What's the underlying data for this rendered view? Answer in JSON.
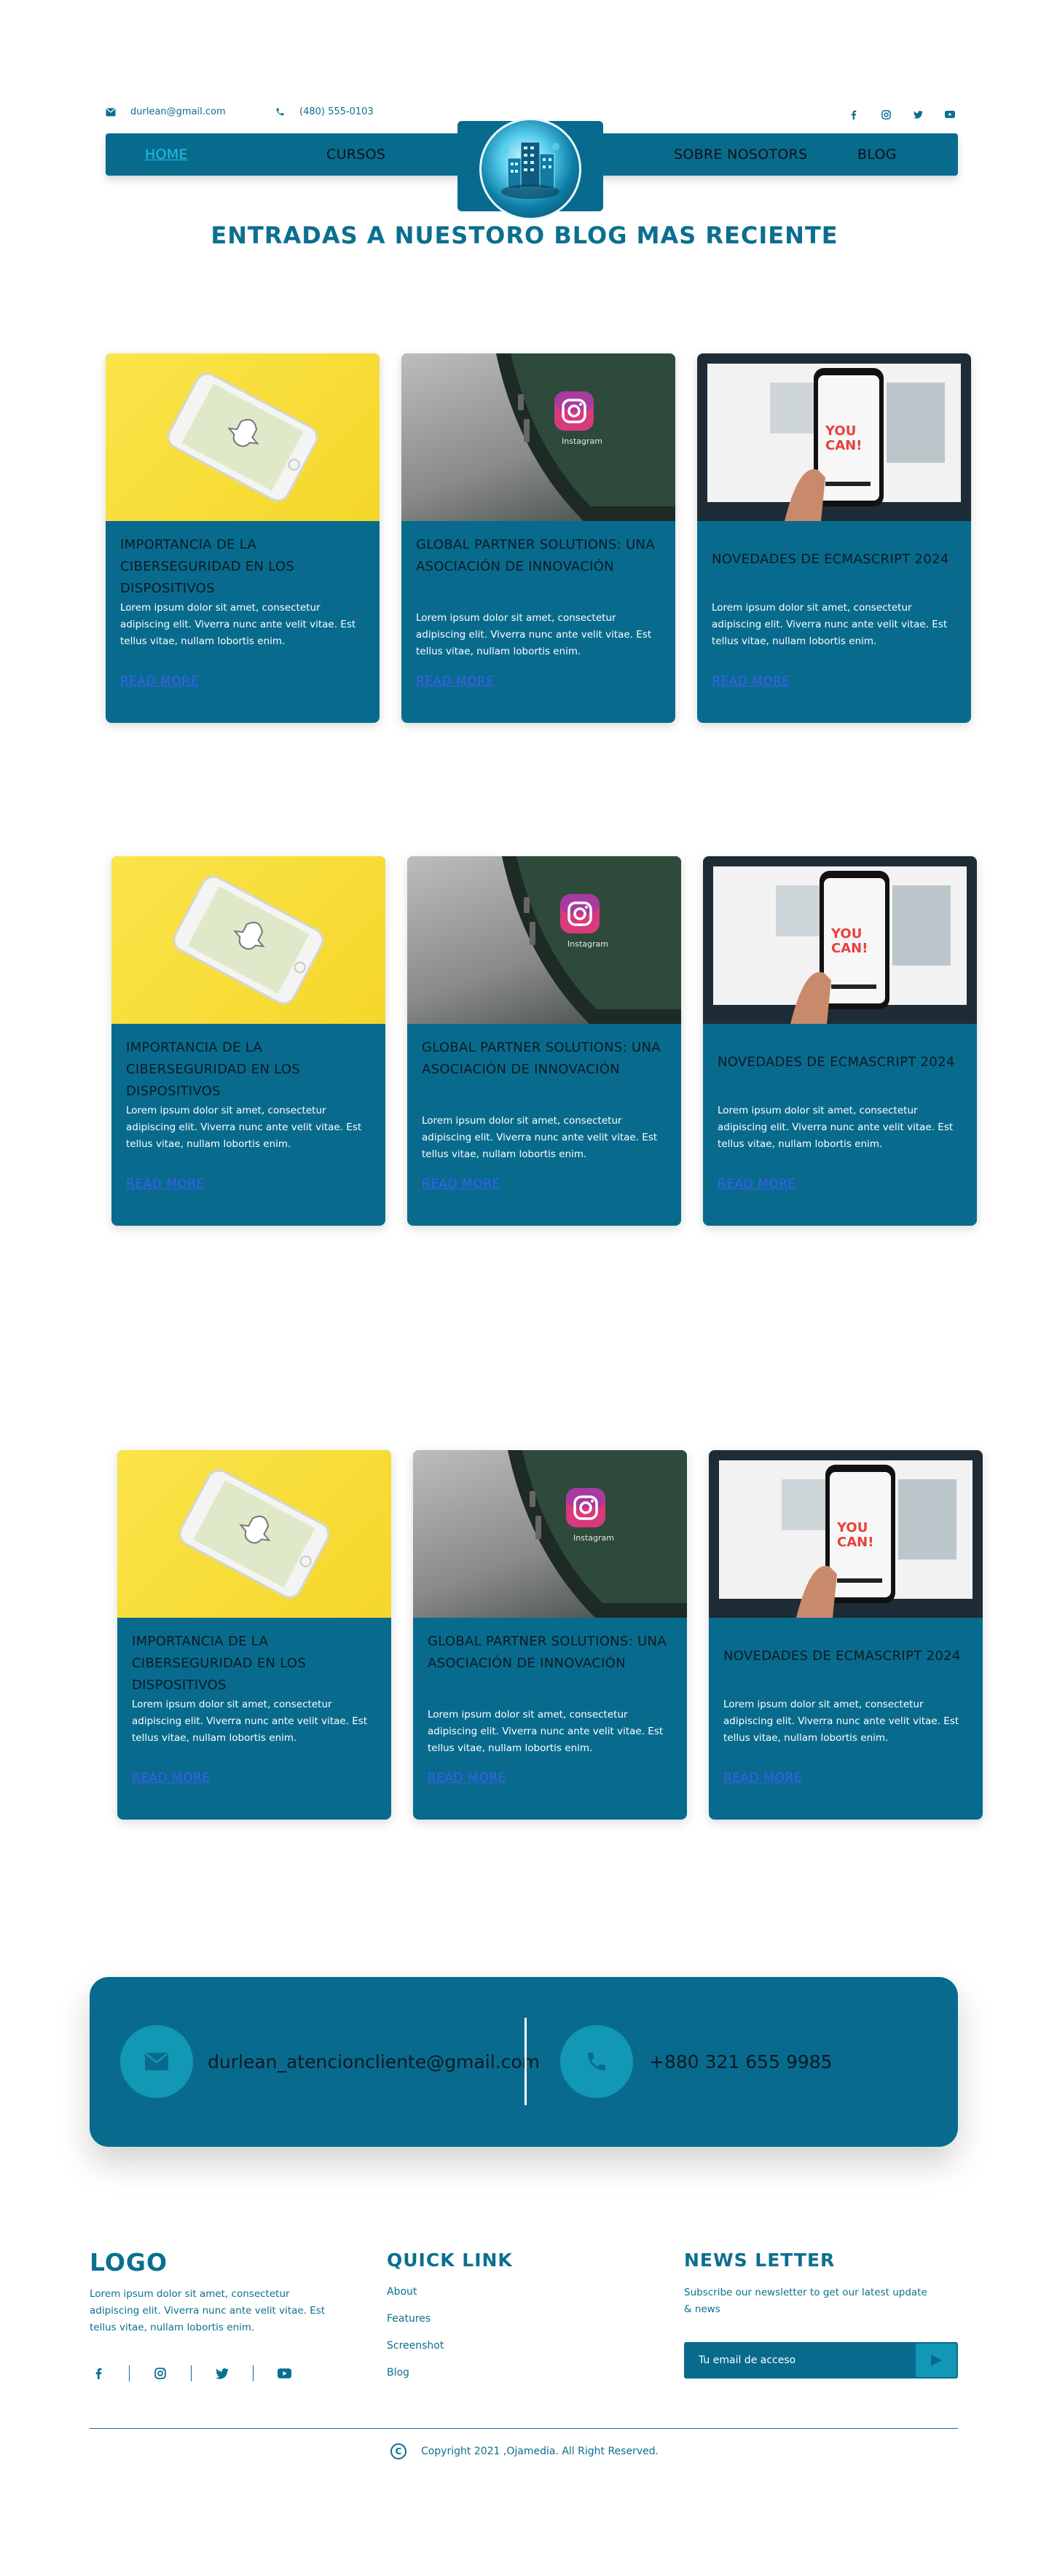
{
  "header": {
    "email": "durlean@gmail.com",
    "phone": "(480) 555-0103",
    "socials": [
      "facebook-icon",
      "instagram-icon",
      "twitter-icon",
      "youtube-icon"
    ],
    "nav": [
      {
        "label": "HOME",
        "active": true
      },
      {
        "label": "CURSOS",
        "active": false
      },
      {
        "label": "SOBRE NOSOTORS",
        "active": false
      },
      {
        "label": "BLOG",
        "active": false
      }
    ]
  },
  "page_title": "ENTRADAS A NUESTORO BLOG MAS RECIENTE",
  "cards": [
    {
      "title": "IMPORTANCIA DE LA CIBERSEGURIDAD EN LOS DISPOSITIVOS",
      "text": "Lorem ipsum dolor sit amet, consectetur adipiscing elit. Viverra nunc ante velit vitae. Est tellus vitae, nullam lobortis enim.",
      "link": "READ MORE"
    },
    {
      "title": "GLOBAL PARTNER SOLUTIONS: UNA ASOCIACIÓN DE INNOVACIÓN",
      "text": "Lorem ipsum dolor sit amet, consectetur adipiscing elit. Viverra nunc ante velit vitae. Est tellus vitae, nullam lobortis enim.",
      "link": "READ MORE"
    },
    {
      "title": "NOVEDADES DE ECMASCRIPT 2024",
      "text": "Lorem ipsum dolor sit amet, consectetur adipiscing elit. Viverra nunc ante velit vitae. Est tellus vitae, nullam lobortis enim.",
      "link": "READ MORE"
    }
  ],
  "contact": {
    "email": "durlean_atencioncliente@gmail.com",
    "phone": "+880 321 655 9985"
  },
  "footer": {
    "logo": "LOGO",
    "description": "Lorem ipsum dolor sit amet, consectetur adipiscing elit. Viverra nunc ante velit vitae. Est tellus vitae, nullam lobortis enim.",
    "quick_link_title": "QUICK LINK",
    "links": [
      "About",
      "Features",
      "Screenshot",
      "Blog"
    ],
    "newsletter_title": "NEWS LETTER",
    "newsletter_text": "Subscribe our newsletter to get our latest update & news",
    "input_placeholder": "Tu email de acceso",
    "copyright": "Copyright 2021 ,Ojamedia. All Right Reserved."
  },
  "colors": {
    "primary": "#086b8e",
    "accent": "#1297b4",
    "nav_active": "#1fc3e6",
    "link": "#3e5cf0"
  }
}
